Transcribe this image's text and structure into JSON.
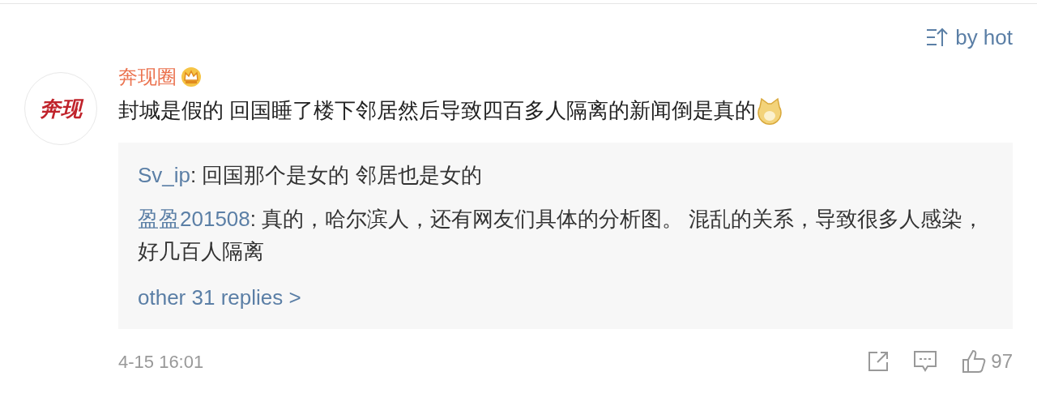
{
  "sort": {
    "label": "by hot"
  },
  "comment": {
    "avatar_text": "奔现",
    "author": "奔现圈",
    "vip": true,
    "text": "封城是假的 回国睡了楼下邻居然后导致四百多人隔离的新闻倒是真的",
    "emoji": true
  },
  "replies": [
    {
      "user": "Sv_ip",
      "text": ": 回国那个是女的 邻居也是女的"
    },
    {
      "user": "盈盈201508",
      "text": ": 真的，哈尔滨人，还有网友们具体的分析图。 混乱的关系，导致很多人感染，好几百人隔离"
    }
  ],
  "more_replies": "other 31 replies >",
  "footer": {
    "time": "4-15 16:01",
    "likes": "97"
  }
}
